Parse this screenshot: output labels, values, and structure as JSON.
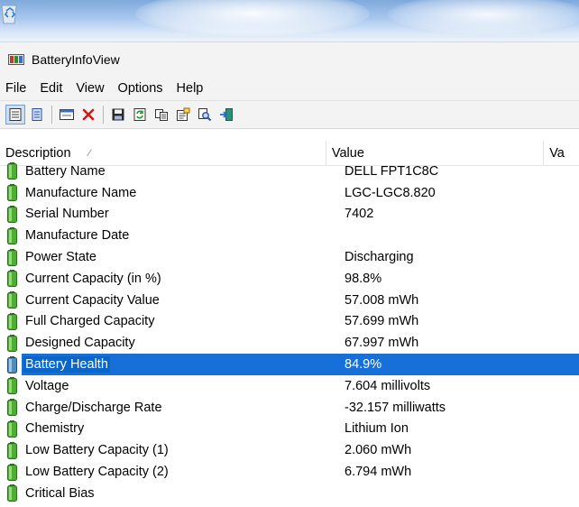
{
  "window": {
    "title": "BatteryInfoView"
  },
  "menu": [
    "File",
    "Edit",
    "View",
    "Options",
    "Help"
  ],
  "columns": {
    "description": "Description",
    "value": "Value",
    "extra": "Va"
  },
  "rows": [
    {
      "description": "Battery Name",
      "value": "DELL FPT1C8C"
    },
    {
      "description": "Manufacture Name",
      "value": "LGC-LGC8.820"
    },
    {
      "description": "Serial Number",
      "value": "7402"
    },
    {
      "description": "Manufacture Date",
      "value": ""
    },
    {
      "description": "Power State",
      "value": "Discharging"
    },
    {
      "description": "Current Capacity (in %)",
      "value": "98.8%"
    },
    {
      "description": "Current Capacity Value",
      "value": "57.008 mWh"
    },
    {
      "description": "Full Charged Capacity",
      "value": "57.699 mWh"
    },
    {
      "description": "Designed Capacity",
      "value": "67.997 mWh"
    },
    {
      "description": "Battery Health",
      "value": "84.9%",
      "selected": true
    },
    {
      "description": "Voltage",
      "value": "7.604 millivolts"
    },
    {
      "description": "Charge/Discharge Rate",
      "value": "-32.157 milliwatts"
    },
    {
      "description": "Chemistry",
      "value": "Lithium Ion"
    },
    {
      "description": "Low Battery Capacity (1)",
      "value": "2.060 mWh"
    },
    {
      "description": "Low Battery Capacity (2)",
      "value": "6.794 mWh"
    },
    {
      "description": "Critical Bias",
      "value": ""
    }
  ],
  "colors": {
    "selection": "#0a66c9",
    "battery_green": "#3c9a2c"
  }
}
